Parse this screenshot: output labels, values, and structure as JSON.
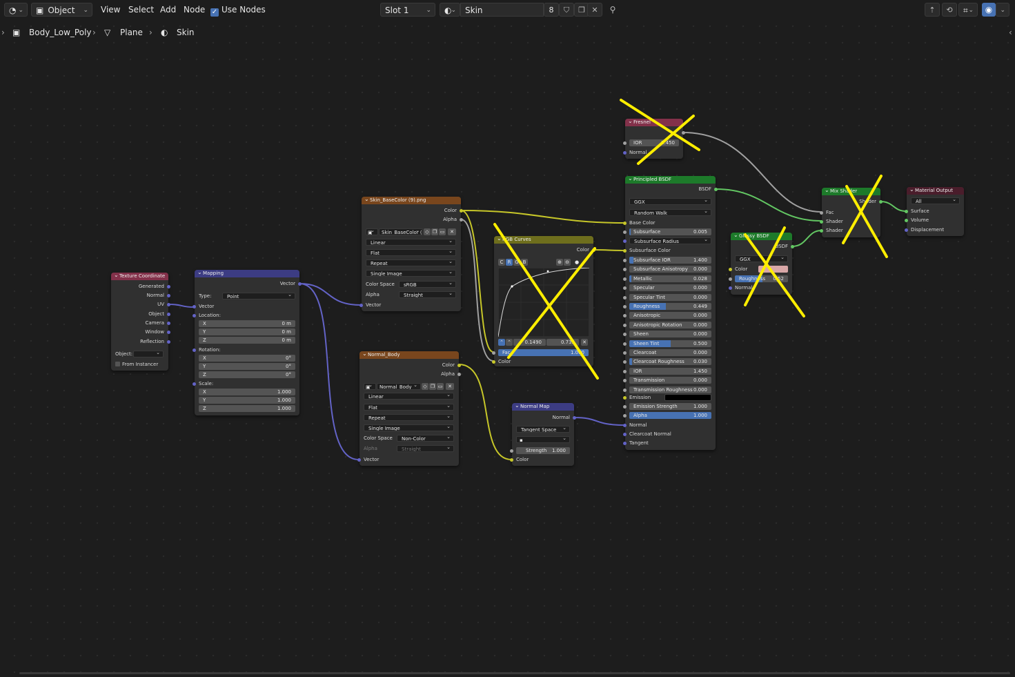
{
  "header": {
    "editor_type_icon": "node-editor-icon",
    "object_mode": "Object",
    "menus": [
      "View",
      "Select",
      "Add",
      "Node"
    ],
    "use_nodes_label": "Use Nodes",
    "slot": "Slot 1",
    "material_icon": "material-sphere-icon",
    "material_name": "Skin",
    "users_count": "8",
    "icons": [
      "fake-user-shield-icon",
      "duplicate-icon",
      "close-icon",
      "pin-icon",
      "parent-node-icon",
      "overlay-icon",
      "snap-icon",
      "gizmo-icon"
    ]
  },
  "breadcrumb": {
    "object": "Body_Low_Poly",
    "mesh": "Plane",
    "material": "Skin"
  },
  "nodes": {
    "texcoord": {
      "title": "Texture Coordinate",
      "outputs": [
        "Generated",
        "Normal",
        "UV",
        "Object",
        "Camera",
        "Window",
        "Reflection"
      ],
      "object_label": "Object:",
      "from_instancer": "From Instancer"
    },
    "mapping": {
      "title": "Mapping",
      "output": "Vector",
      "type_label": "Type:",
      "type_value": "Point",
      "vector_label": "Vector",
      "location_label": "Location:",
      "location": [
        [
          "X",
          "0 m"
        ],
        [
          "Y",
          "0 m"
        ],
        [
          "Z",
          "0 m"
        ]
      ],
      "rotation_label": "Rotation:",
      "rotation": [
        [
          "X",
          "0°"
        ],
        [
          "Y",
          "0°"
        ],
        [
          "Z",
          "0°"
        ]
      ],
      "scale_label": "Scale:",
      "scale": [
        [
          "X",
          "1.000"
        ],
        [
          "Y",
          "1.000"
        ],
        [
          "Z",
          "1.000"
        ]
      ]
    },
    "basecolor": {
      "title": "Skin_BaseColor (9).png",
      "outputs": [
        "Color",
        "Alpha"
      ],
      "image_name": "Skin_BaseColor (9)...",
      "interpolation": "Linear",
      "projection": "Flat",
      "extension": "Repeat",
      "source": "Single Image",
      "colorspace_label": "Color Space",
      "colorspace": "sRGB",
      "alpha_label": "Alpha",
      "alpha": "Straight",
      "input": "Vector"
    },
    "normalbody": {
      "title": "Normal_Body",
      "outputs": [
        "Color",
        "Alpha"
      ],
      "image_name": "Normal_Body",
      "interpolation": "Linear",
      "projection": "Flat",
      "extension": "Repeat",
      "source": "Single Image",
      "colorspace_label": "Color Space",
      "colorspace": "Non-Color",
      "alpha_label": "Alpha",
      "alpha": "Straight",
      "input": "Vector"
    },
    "rgbcurves": {
      "title": "RGB Curves",
      "output": "Color",
      "channels": [
        "C",
        "R",
        "G",
        "B"
      ],
      "point_x": "0.1490",
      "point_y": "0.735",
      "fac_label": "Fac",
      "fac_value": "1.000",
      "input": "Color"
    },
    "normalmap": {
      "title": "Normal Map",
      "output": "Normal",
      "space": "Tangent Space",
      "uvmap": "",
      "strength_label": "Strength",
      "strength": "1.000",
      "input": "Color"
    },
    "fresnel": {
      "title": "Fresnel",
      "ior_label": "IOR",
      "ior": "1.450",
      "input": "Normal"
    },
    "principled": {
      "title": "Principled BSDF",
      "output": "BSDF",
      "distribution": "GGX",
      "subsurface_method": "Random Walk",
      "base_color": "Base Color",
      "subsurface": [
        "Subsurface",
        "0.005"
      ],
      "subsurface_radius": "Subsurface Radius",
      "subsurface_color": "Subsurface Color",
      "params": [
        [
          "Subsurface IOR",
          "1.400",
          0.05
        ],
        [
          "Subsurface Anisotropy",
          "0.000",
          0
        ],
        [
          "Metallic",
          "0.028",
          0.028
        ],
        [
          "Specular",
          "0.000",
          0
        ],
        [
          "Specular Tint",
          "0.000",
          0
        ],
        [
          "Roughness",
          "0.449",
          0.449
        ],
        [
          "Anisotropic",
          "0.000",
          0
        ],
        [
          "Anisotropic Rotation",
          "0.000",
          0
        ],
        [
          "Sheen",
          "0.000",
          0
        ],
        [
          "Sheen Tint",
          "0.500",
          0.5
        ],
        [
          "Clearcoat",
          "0.000",
          0
        ],
        [
          "Clearcoat Roughness",
          "0.030",
          0.03
        ],
        [
          "IOR",
          "1.450",
          0
        ],
        [
          "Transmission",
          "0.000",
          0
        ],
        [
          "Transmission Roughness",
          "0.000",
          0
        ]
      ],
      "emission_label": "Emission",
      "emission_strength": [
        "Emission Strength",
        "1.000"
      ],
      "alpha": [
        "Alpha",
        "1.000"
      ],
      "inputs_tail": [
        "Normal",
        "Clearcoat Normal",
        "Tangent"
      ]
    },
    "glossy": {
      "title": "Glossy BSDF",
      "output": "BSDF",
      "distribution": "GGX",
      "color_label": "Color",
      "roughness_label": "Roughness",
      "roughness": "0.52",
      "normal": "Normal"
    },
    "mixshader": {
      "title": "Mix Shader",
      "output": "Shader",
      "inputs": [
        "Fac",
        "Shader",
        "Shader"
      ]
    },
    "output": {
      "title": "Material Output",
      "target": "All",
      "inputs": [
        "Surface",
        "Volume",
        "Displacement"
      ]
    }
  },
  "colors": {
    "header_input": "#83314a",
    "header_vector": "#3c3c83",
    "header_texture": "#79461d",
    "header_color": "#6e6e1d",
    "header_shader": "#1d7a2a",
    "header_output": "#4a1d2b",
    "link_yellow": "#c7c729",
    "link_violet": "#6363c7",
    "link_green": "#63c763",
    "link_gray": "#a1a1a1",
    "cross_yellow": "#ffee00",
    "accent_blue": "#4772b3",
    "glossy_color": "#d8a7a7"
  }
}
